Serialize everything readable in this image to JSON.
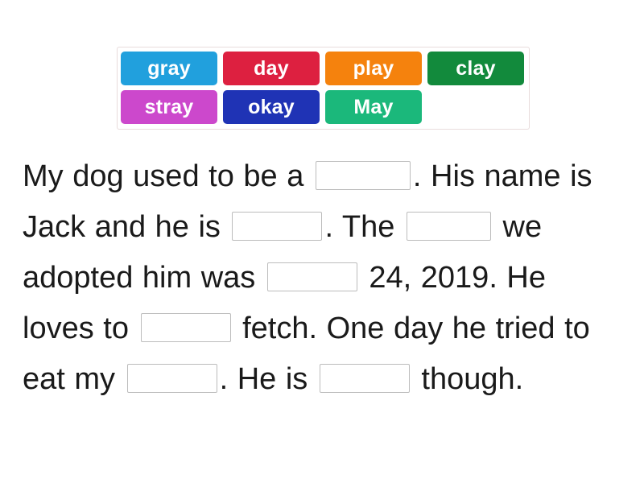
{
  "word_bank": {
    "name": "word-bank",
    "rows": [
      [
        {
          "label": "gray",
          "color": "#21a0dd"
        },
        {
          "label": "day",
          "color": "#dd2040"
        },
        {
          "label": "play",
          "color": "#f5820d"
        },
        {
          "label": "clay",
          "color": "#128a3c"
        }
      ],
      [
        {
          "label": "stray",
          "color": "#cc48cc"
        },
        {
          "label": "okay",
          "color": "#1f33b5"
        },
        {
          "label": "May",
          "color": "#1bb87b"
        }
      ]
    ]
  },
  "passage": {
    "segments": [
      {
        "type": "text",
        "value": "My dog used to be a "
      },
      {
        "type": "blank",
        "value": "",
        "width": "w118",
        "index": 1
      },
      {
        "type": "text",
        "value": ". His name is Jack and he is "
      },
      {
        "type": "blank",
        "value": "",
        "width": "w112",
        "index": 2
      },
      {
        "type": "text",
        "value": ". The "
      },
      {
        "type": "blank",
        "value": "",
        "width": "w105",
        "index": 3
      },
      {
        "type": "text",
        "value": " we adopted him was "
      },
      {
        "type": "blank",
        "value": "",
        "width": "w112",
        "index": 4
      },
      {
        "type": "text",
        "value": " 24, 2019. He loves to "
      },
      {
        "type": "blank",
        "value": "",
        "width": "w112",
        "index": 5
      },
      {
        "type": "text",
        "value": " fetch. One day he tried to eat my "
      },
      {
        "type": "blank",
        "value": "",
        "width": "w112",
        "index": 6
      },
      {
        "type": "text",
        "value": ". He is "
      },
      {
        "type": "blank",
        "value": "",
        "width": "w112",
        "index": 7
      },
      {
        "type": "text",
        "value": " though."
      }
    ]
  }
}
